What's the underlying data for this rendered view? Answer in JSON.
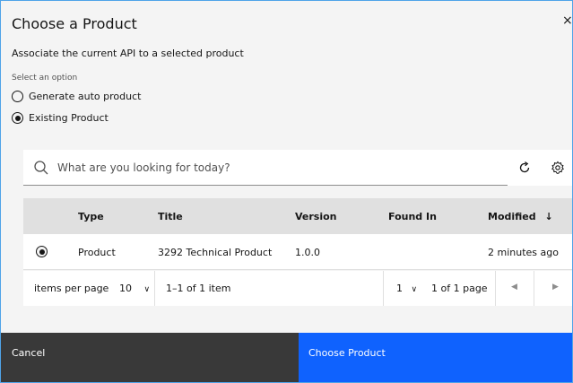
{
  "dialog": {
    "title": "Choose a Product",
    "close_glyph": "×",
    "description": "Associate the current API to a selected product",
    "select_label": "Select an option",
    "options": [
      {
        "label": "Generate auto product",
        "selected": false
      },
      {
        "label": "Existing Product",
        "selected": true
      }
    ]
  },
  "search": {
    "placeholder": "What are you looking for today?",
    "value": "",
    "icon": "search-icon",
    "refresh_icon": "refresh-icon",
    "settings_icon": "settings-icon"
  },
  "table": {
    "headers": {
      "type": "Type",
      "title": "Title",
      "version": "Version",
      "found_in": "Found In",
      "modified": "Modified",
      "modified_sort": "↓"
    },
    "rows": [
      {
        "selected": true,
        "type": "Product",
        "title": "3292 Technical Product",
        "version": "1.0.0",
        "found_in": "",
        "modified": "2 minutes ago"
      }
    ]
  },
  "pagination": {
    "items_per_page_label": "items per page",
    "items_per_page": "10",
    "range": "1–1 of 1 item",
    "page": "1",
    "page_total": "1 of 1 page",
    "prev_glyph": "◀",
    "next_glyph": "▶",
    "dropdown_glyph": "∨"
  },
  "footer": {
    "cancel_label": "Cancel",
    "primary_label": "Choose Product"
  },
  "colors": {
    "primary": "#0f62fe",
    "secondary": "#393939",
    "border": "#4fa3e8"
  }
}
